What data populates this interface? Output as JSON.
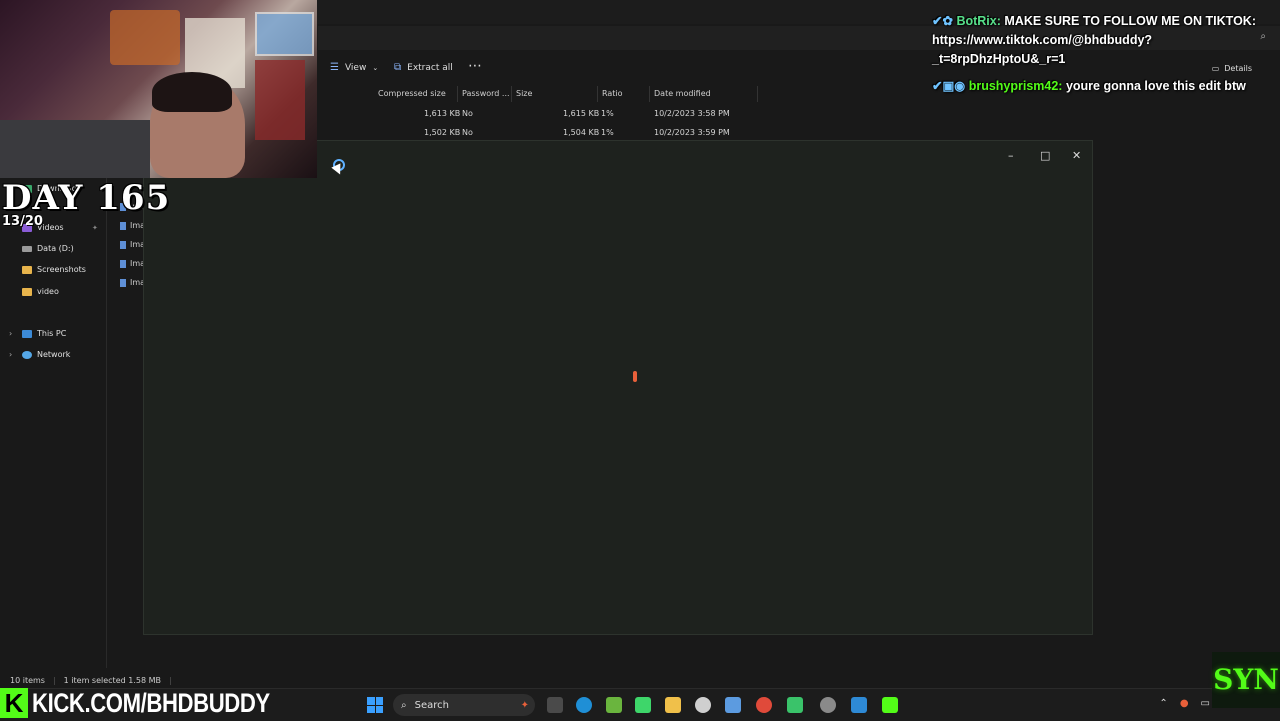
{
  "explorer": {
    "toolbar": {
      "view_label": "View",
      "extract_label": "Extract all",
      "more_label": "⋯",
      "details_label": "Details"
    },
    "columns": [
      "Compressed size",
      "Password ...",
      "Size",
      "Ratio",
      "Date modified"
    ],
    "rows": [
      {
        "compressed": "1,613 KB",
        "password": "No",
        "size": "1,615 KB",
        "ratio": "1%",
        "modified": "10/2/2023 3:58 PM"
      },
      {
        "compressed": "1,502 KB",
        "password": "No",
        "size": "1,504 KB",
        "ratio": "1%",
        "modified": "10/2/2023 3:59 PM"
      }
    ],
    "nav": {
      "downloads": "Downloads",
      "videos": "Videos",
      "data_drive": "Data (D:)",
      "screenshots": "Screenshots",
      "video": "video",
      "this_pc": "This PC",
      "network": "Network"
    },
    "file_stubs": [
      "Ima",
      "Ima",
      "Ima",
      "Ima",
      "Ima"
    ],
    "status": {
      "items": "10 items",
      "selected": "1 item selected  1.58 MB"
    }
  },
  "window_controls": {
    "minimize": "–",
    "maximize": "□",
    "close": "✕"
  },
  "overlay": {
    "day_label": "DAY 165",
    "day_sub": "13/20",
    "kick_label": "KICK.COM/BHDBUDDY",
    "kick_letter": "K",
    "syn_logo": "SYN"
  },
  "chat": [
    {
      "badge": "✔✿",
      "user": "BotRix:",
      "message": "MAKE SURE TO FOLLOW ME ON TIKTOK: https://www.tiktok.com/@bhdbuddy?_t=8rpDhzHptoU&_r=1"
    },
    {
      "badge": "✔▣◉",
      "user": "brushyprism42:",
      "message": "youre gonna love this edit btw"
    }
  ],
  "taskbar": {
    "search_label": "Search",
    "search_icon": "search-icon"
  },
  "colors": {
    "kick_green": "#53fc18",
    "accent_blue": "#3aa0ff"
  }
}
